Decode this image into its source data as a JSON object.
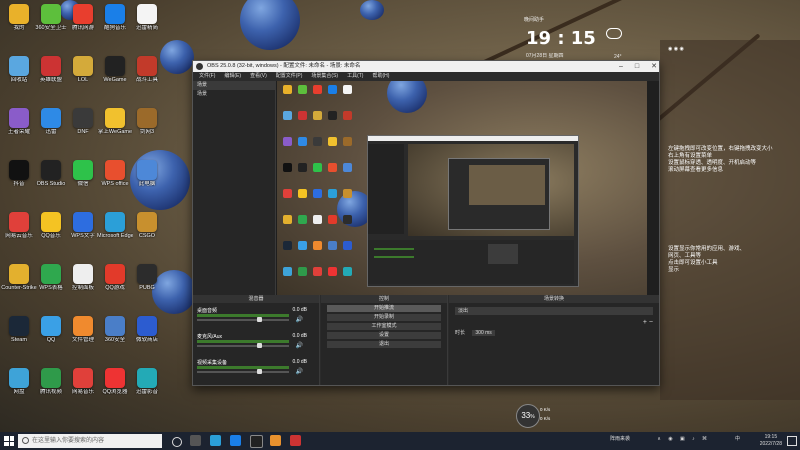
{
  "desktop_icons": [
    {
      "label": "我的",
      "color": "#e9b12a"
    },
    {
      "label": "360安全卫士",
      "color": "#5dbf3c"
    },
    {
      "label": "腾讯网游",
      "color": "#e83e2e"
    },
    {
      "label": "酷狗音乐",
      "color": "#1a7fe8"
    },
    {
      "label": "迅雷精简",
      "color": "#f4f4f4"
    },
    {
      "label": "回收站",
      "color": "#5aa7e0"
    },
    {
      "label": "英雄联盟",
      "color": "#c33"
    },
    {
      "label": "LOL",
      "color": "#d4aa3a"
    },
    {
      "label": "WeGame",
      "color": "#222"
    },
    {
      "label": "战斗工具",
      "color": "#c23a2a"
    },
    {
      "label": "王者荣耀",
      "color": "#8a5cc9"
    },
    {
      "label": "迅雷",
      "color": "#2e8ae6"
    },
    {
      "label": "DNF",
      "color": "#3a3a3a"
    },
    {
      "label": "掌上WeGame",
      "color": "#f1c12e"
    },
    {
      "label": "剑网3",
      "color": "#9b6a2a"
    },
    {
      "label": "抖音",
      "color": "#111"
    },
    {
      "label": "OBS Studio",
      "color": "#222"
    },
    {
      "label": "微信",
      "color": "#2ec24a"
    },
    {
      "label": "WPS office",
      "color": "#e84f2e"
    },
    {
      "label": "此电脑",
      "color": "#4d88d8"
    },
    {
      "label": "网易云音乐",
      "color": "#e0403a"
    },
    {
      "label": "QQ音乐",
      "color": "#f4c323"
    },
    {
      "label": "WPS文字",
      "color": "#2d6de0"
    },
    {
      "label": "Microsoft Edge",
      "color": "#2b9fd8"
    },
    {
      "label": "CSGO",
      "color": "#c8902e"
    },
    {
      "label": "Counter-Strike",
      "color": "#e3b02e"
    },
    {
      "label": "WPS表格",
      "color": "#2fa84e"
    },
    {
      "label": "控制面板",
      "color": "#eeeeee"
    },
    {
      "label": "QQ游戏",
      "color": "#e23a2a"
    },
    {
      "label": "PUBG",
      "color": "#2c2c2c"
    },
    {
      "label": "Steam",
      "color": "#1b2838"
    },
    {
      "label": "QQ",
      "color": "#3aa0e6"
    },
    {
      "label": "文件管理",
      "color": "#f08a2e"
    },
    {
      "label": "360安全",
      "color": "#4a7ec8"
    },
    {
      "label": "微软商店",
      "color": "#2c5cd0"
    },
    {
      "label": "网盘",
      "color": "#3ea3d8"
    },
    {
      "label": "腾讯视频",
      "color": "#2f9a4a"
    },
    {
      "label": "网易音乐",
      "color": "#e0403a"
    },
    {
      "label": "QQ浏览器",
      "color": "#e33"
    },
    {
      "label": "迅雷影音",
      "color": "#23aab6"
    }
  ],
  "widget": {
    "time": "19 : 15",
    "top_label": "晚间助手",
    "date_label": "07月28日 星期四",
    "temp": "24°"
  },
  "right_panel": {
    "lines": [
      "左键拖拽即可改变位置，右键拖拽改变大小",
      "右上角有设置菜单",
      "设置鼠标穿透、透明度、开机启动等",
      "滚动屏幕查看更多信息"
    ],
    "lines2": [
      "设置显示你常用的应用、游戏、",
      "网页、工具等",
      "点击即可设置小工具",
      "显示"
    ]
  },
  "obs": {
    "title": "OBS 25.0.8 (32-bit, windows) - 配置文件: 未命名 - 场景: 未命名",
    "menu": [
      "文件(F)",
      "编辑(E)",
      "查看(V)",
      "配置文件(P)",
      "场景集合(S)",
      "工具(T)",
      "帮助(H)"
    ],
    "scenes_label": "场景",
    "scene_item": "场景",
    "sources_label": "来源",
    "mixer_label": "混音器",
    "controls_label": "控制",
    "transitions_label": "场景转换",
    "mixer_items": [
      {
        "name": "桌面音频",
        "db": "0.0 dB"
      },
      {
        "name": "麦克风/Aux",
        "db": "0.0 dB"
      },
      {
        "name": "视频采集设备",
        "db": "0.0 dB"
      }
    ],
    "controls": [
      "开始推流",
      "开始录制",
      "工作室模式",
      "设置",
      "退出"
    ],
    "transition_name": "淡出",
    "duration_label": "时长",
    "duration_value": "300 ms"
  },
  "speed_widget": {
    "value": "33",
    "unit": "%",
    "up": "0 K/s",
    "down": "0 K/s"
  },
  "taskbar": {
    "search_placeholder": "在这里输入你要搜索的内容",
    "tray_lang": "中",
    "tray_time": "19:15",
    "tray_date": "2022/7/28",
    "tray_weather": "阵雨来袭"
  }
}
